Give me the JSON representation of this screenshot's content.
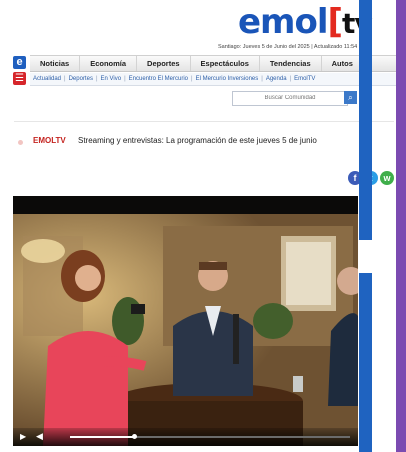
{
  "logo": {
    "word": "emol",
    "bracket": "[",
    "suffix": "tv"
  },
  "dateline": "Santiago: Jueves 5 de Junio del 2025 | Actualizado 11:54",
  "nav": {
    "e_badge": "e",
    "menu_icon": "menu-icon",
    "main_items": [
      "Noticias",
      "Economía",
      "Deportes",
      "Espectáculos",
      "Tendencias",
      "Autos"
    ],
    "sub_items": [
      "Actualidad",
      "Deportes",
      "En Vivo",
      "Encuentro El Mercurio",
      "El Mercurio Inversiones",
      "Agenda",
      "EmolTV"
    ]
  },
  "search": {
    "placeholder": "Buscar Comunidad",
    "icon": "search-icon"
  },
  "ticker": {
    "label": "EMOLTV",
    "text": "Streaming y entrevistas: La programación de este jueves 5 de junio"
  },
  "social": [
    {
      "name": "facebook-icon",
      "glyph": "f",
      "color": "#3b5bb8"
    },
    {
      "name": "twitter-icon",
      "glyph": "t",
      "color": "#2a9de6"
    },
    {
      "name": "whatsapp-icon",
      "glyph": "w",
      "color": "#3fae4a"
    }
  ],
  "video": {
    "progress": 0.23,
    "play_icon": "play-icon",
    "volume_icon": "volume-icon",
    "play_glyph": "▶",
    "volume_glyph": "◀"
  },
  "colors": {
    "brand_blue": "#1a55b8",
    "brand_red": "#e32a1f",
    "accent_purple": "#7b4bb1",
    "accent_blue": "#1f63c0"
  }
}
